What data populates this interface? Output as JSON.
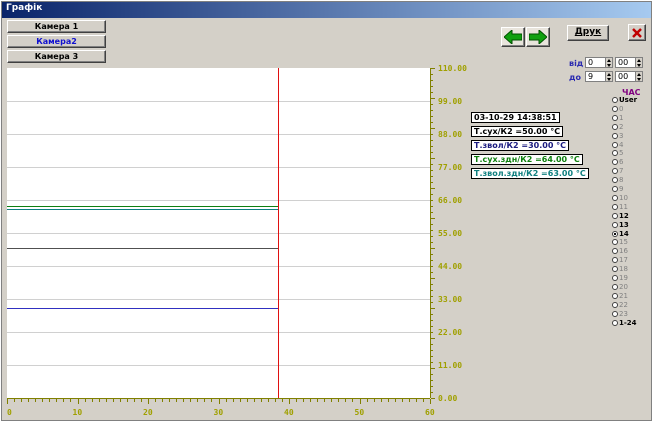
{
  "window": {
    "title": "Графік"
  },
  "cameras": [
    {
      "label": "Камера 1"
    },
    {
      "label": "Камера2"
    },
    {
      "label": "Камера 3"
    }
  ],
  "toolbar": {
    "print_label": "Друк",
    "back_icon": "arrow-left-icon",
    "forward_icon": "arrow-right-icon",
    "close_icon": "close-icon"
  },
  "time_range": {
    "from_label": "від",
    "from_hour": "0",
    "from_min": "00",
    "to_label": "до",
    "to_hour": "9",
    "to_min": "00"
  },
  "info": {
    "timestamp": "03-10-29   14:38:51",
    "lines": [
      {
        "text": "Т.сух/К2 =50.00 °C",
        "color": "#000000"
      },
      {
        "text": "Т.звол/К2 =30.00 °C",
        "color": "#1a1a80"
      },
      {
        "text": "Т.сух.здн/К2 =64.00 °C",
        "color": "#108010"
      },
      {
        "text": "Т.звол.здн/К2 =63.00 °C",
        "color": "#108080"
      }
    ]
  },
  "hour_panel": {
    "title": "ЧАС",
    "options": [
      "User",
      "0",
      "1",
      "2",
      "3",
      "4",
      "5",
      "6",
      "7",
      "8",
      "9",
      "10",
      "11",
      "12",
      "13",
      "14",
      "15",
      "16",
      "17",
      "18",
      "19",
      "20",
      "21",
      "22",
      "23",
      "1-24"
    ],
    "enabled": [
      "User",
      "12",
      "13",
      "14",
      "1-24"
    ],
    "selected": "14"
  },
  "chart_data": {
    "type": "line",
    "ylim": [
      0,
      110
    ],
    "xlim": [
      0,
      60
    ],
    "y_ticks": [
      "110.00",
      "99.00",
      "88.00",
      "77.00",
      "66.00",
      "55.00",
      "44.00",
      "33.00",
      "22.00",
      "11.00",
      "0.00"
    ],
    "x_ticks": [
      "0",
      "10",
      "20",
      "30",
      "40",
      "50",
      "60"
    ],
    "cursor_x": 38.5,
    "series": [
      {
        "values": [
          64,
          64
        ],
        "color": "#108010"
      },
      {
        "values": [
          63,
          63
        ],
        "color": "#108080"
      },
      {
        "values": [
          50,
          50
        ],
        "color": "#505050"
      },
      {
        "values": [
          30,
          30
        ],
        "color": "#3030c0"
      }
    ],
    "series_x": [
      0,
      38.5
    ],
    "grid": true
  }
}
